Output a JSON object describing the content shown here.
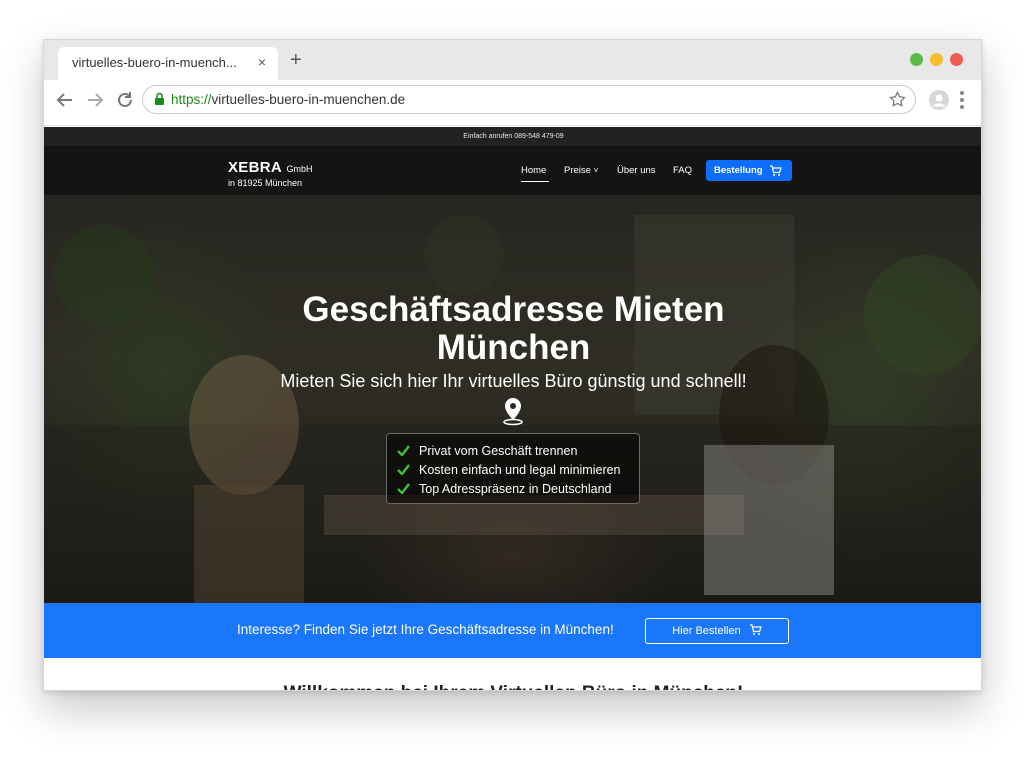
{
  "browser": {
    "tab_title": "virtuelles-buero-in-muench...",
    "tab_close": "×",
    "new_tab": "+",
    "url_protocol": "https://",
    "url_rest": "virtuelles-buero-in-muenchen.de",
    "window_controls": [
      "#5cbb45",
      "#f5be2e",
      "#ee5b53"
    ],
    "icons": [
      "back-arrow-icon",
      "forward-arrow-icon",
      "reload-icon",
      "lock-icon",
      "star-icon",
      "profile-icon",
      "kebab-menu-icon"
    ]
  },
  "site": {
    "topbar_text": "Einfach anrufen 089-548 479-09",
    "logo": {
      "name": "XEBRA",
      "suffix": "GmbH",
      "sub": "in 81925 München"
    },
    "nav": {
      "home": "Home",
      "preise": "Preise",
      "preise_caret": "˅",
      "ueber_uns": "Über uns",
      "faq": "FAQ",
      "order": "Bestellung"
    },
    "hero": {
      "title_line1": "Geschäftsadresse Mieten",
      "title_line2": "München",
      "subtitle": "Mieten Sie sich hier Ihr virtuelles Büro günstig und schnell!",
      "features": [
        "Privat vom Geschäft trennen",
        "Kosten einfach und legal minimieren",
        "Top Adresspräsenz in Deutschland"
      ]
    },
    "cta": {
      "text": "Interesse? Finden Sie jetzt Ihre Geschäftsadresse in München!",
      "button": "Hier Bestellen"
    },
    "welcome_heading": "Willkommen bei Ihrem Virtuellen Büro in München!"
  },
  "colors": {
    "brand_blue": "#1a76fb",
    "nav_bg": "#141414",
    "topbar_bg": "#222222",
    "check_green": "#3fbf3f"
  }
}
